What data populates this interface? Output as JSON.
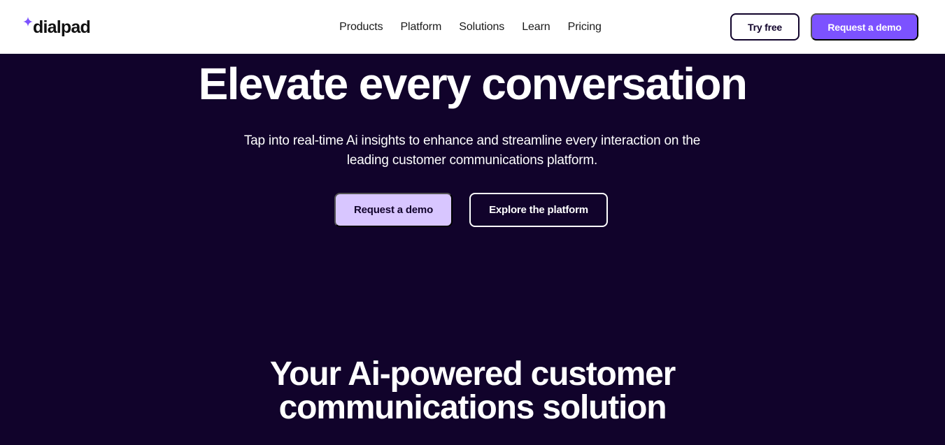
{
  "header": {
    "logo_text": "dialpad",
    "nav": [
      "Products",
      "Platform",
      "Solutions",
      "Learn",
      "Pricing"
    ],
    "try_free_label": "Try free",
    "request_demo_label": "Request a demo"
  },
  "hero": {
    "title": "Elevate every conversation",
    "subtitle": "Tap into real-time Ai insights to enhance and streamline every interaction on the leading customer communications platform.",
    "request_demo_label": "Request a demo",
    "explore_label": "Explore the platform"
  },
  "section": {
    "title_line1": "Your Ai-powered customer",
    "title_line2": "communications solution"
  },
  "colors": {
    "brand_purple": "#7c52ff",
    "light_purple": "#d8c6ff",
    "dark_bg": "#11032b",
    "header_bg": "#ffffff"
  },
  "icons": {
    "logo_mark": "sparkle-icon"
  }
}
